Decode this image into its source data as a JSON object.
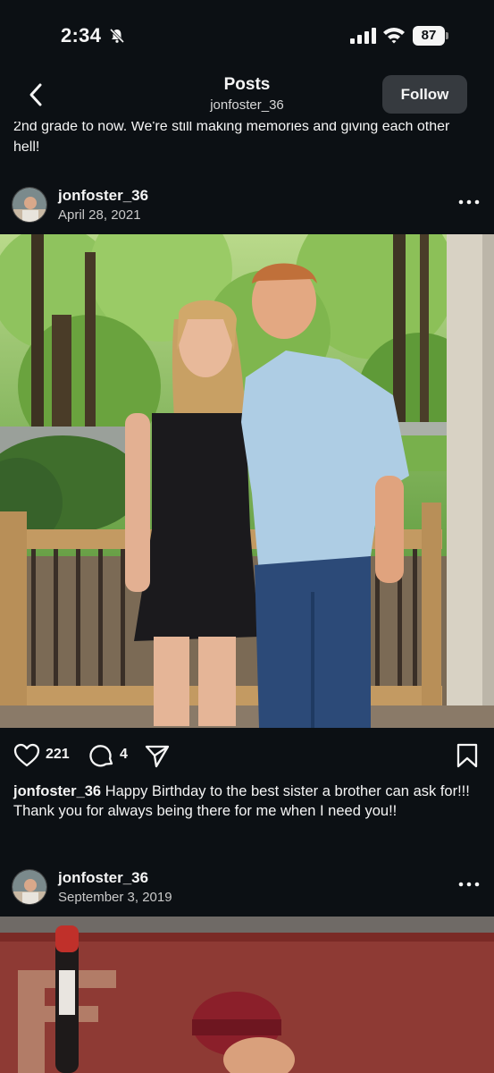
{
  "status_bar": {
    "time": "2:34",
    "battery": "87",
    "icons": [
      "bell-slash-icon",
      "signal-icon",
      "wifi-icon",
      "battery-icon"
    ]
  },
  "header": {
    "title": "Posts",
    "subtitle": "jonfoster_36",
    "follow_label": "Follow"
  },
  "previous_caption": {
    "text": "2nd grade to now. We're still making memories and giving each other hell!"
  },
  "posts": [
    {
      "username": "jonfoster_36",
      "date": "April 28, 2021",
      "likes": "221",
      "comments": "4",
      "caption": "Happy Birthday to the best sister a brother can ask for!!! Thank you for always being there for me when I need you!!"
    },
    {
      "username": "jonfoster_36",
      "date": "September 3, 2019"
    }
  ],
  "colors": {
    "background": "#0c1014",
    "text": "#f5f5f5",
    "follow_button": "#363a3f"
  }
}
